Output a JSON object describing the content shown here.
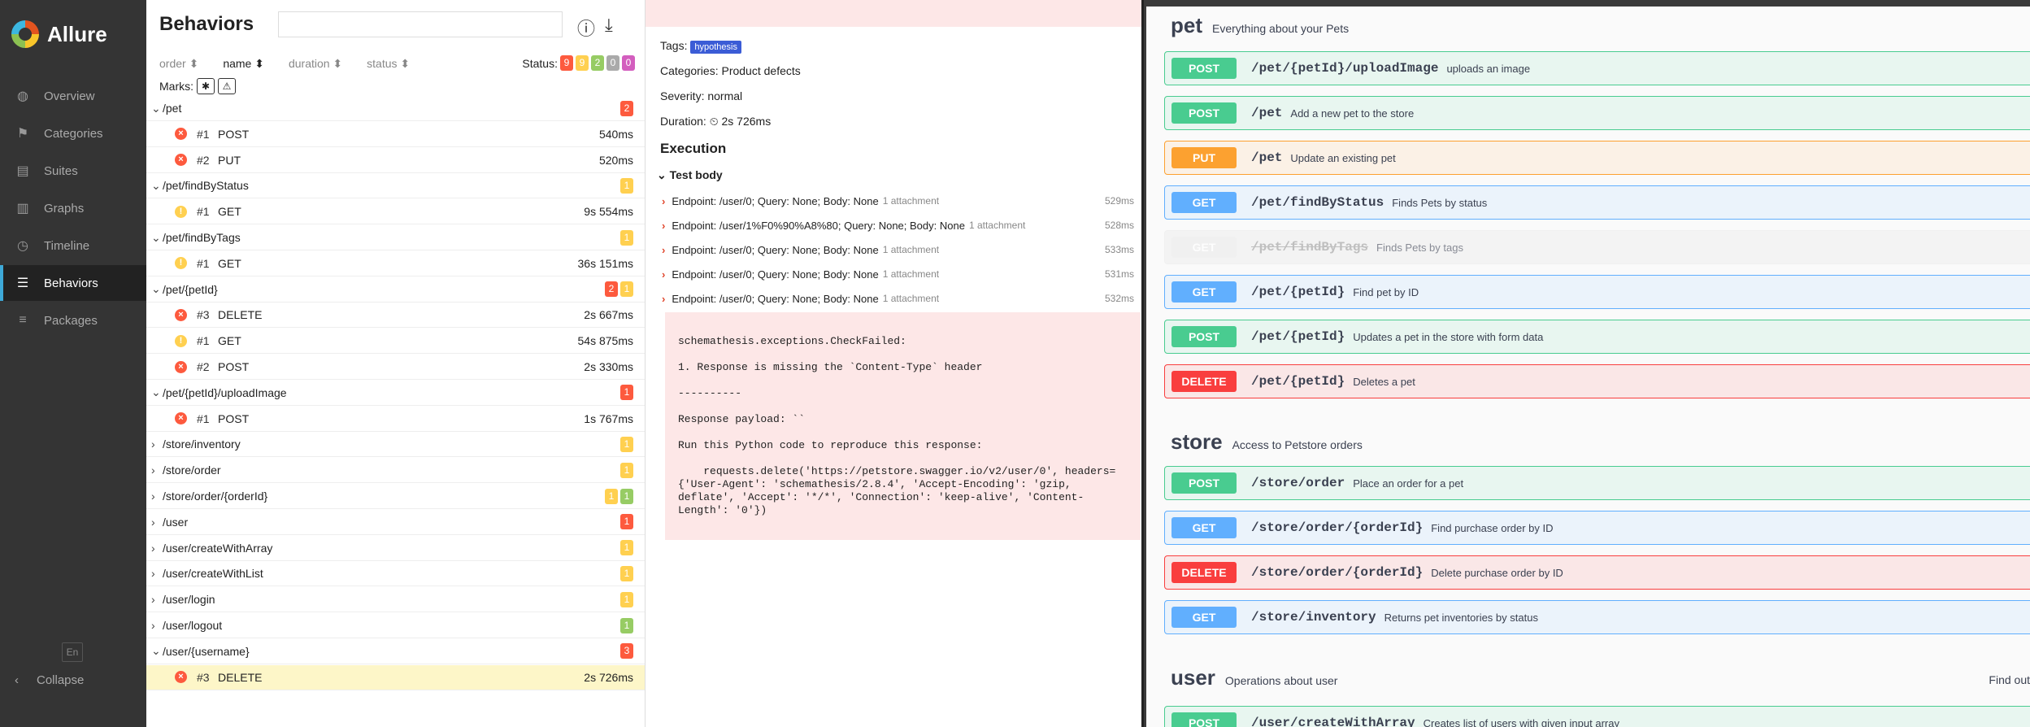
{
  "sidebar": {
    "brand": "Allure",
    "items": [
      {
        "label": "Overview",
        "icon": "overview-icon",
        "glyph": "◍"
      },
      {
        "label": "Categories",
        "icon": "flag-icon",
        "glyph": "⚑"
      },
      {
        "label": "Suites",
        "icon": "briefcase-icon",
        "glyph": "▤"
      },
      {
        "label": "Graphs",
        "icon": "bar-chart-icon",
        "glyph": "▥"
      },
      {
        "label": "Timeline",
        "icon": "clock-icon",
        "glyph": "◷"
      },
      {
        "label": "Behaviors",
        "icon": "list-icon",
        "glyph": "☰"
      },
      {
        "label": "Packages",
        "icon": "packages-icon",
        "glyph": "≡"
      }
    ],
    "lang": "En",
    "collapse": "Collapse"
  },
  "tree": {
    "title": "Behaviors",
    "sort": {
      "order": "order ⬍",
      "name": "name ⬍",
      "duration": "duration ⬍",
      "status": "status ⬍"
    },
    "status_label": "Status:",
    "status_counts": [
      "9",
      "9",
      "2",
      "0",
      "0"
    ],
    "marks_label": "Marks:",
    "marks": [
      "✱",
      "⚠"
    ],
    "rows": [
      {
        "type": "group",
        "label": "/pet",
        "badges": [
          {
            "v": "2",
            "c": "red"
          }
        ],
        "open": true
      },
      {
        "type": "leaf",
        "st": "fail",
        "num": "#1",
        "label": "POST",
        "dur": "540ms"
      },
      {
        "type": "leaf",
        "st": "fail",
        "num": "#2",
        "label": "PUT",
        "dur": "520ms"
      },
      {
        "type": "group",
        "label": "/pet/findByStatus",
        "badges": [
          {
            "v": "1",
            "c": "yel"
          }
        ],
        "open": true
      },
      {
        "type": "leaf",
        "st": "brk",
        "num": "#1",
        "label": "GET",
        "dur": "9s 554ms"
      },
      {
        "type": "group",
        "label": "/pet/findByTags",
        "badges": [
          {
            "v": "1",
            "c": "yel"
          }
        ],
        "open": true
      },
      {
        "type": "leaf",
        "st": "brk",
        "num": "#1",
        "label": "GET",
        "dur": "36s 151ms"
      },
      {
        "type": "group",
        "label": "/pet/{petId}",
        "badges": [
          {
            "v": "2",
            "c": "red"
          },
          {
            "v": "1",
            "c": "yel"
          }
        ],
        "open": true
      },
      {
        "type": "leaf",
        "st": "fail",
        "num": "#3",
        "label": "DELETE",
        "dur": "2s 667ms"
      },
      {
        "type": "leaf",
        "st": "brk",
        "num": "#1",
        "label": "GET",
        "dur": "54s 875ms"
      },
      {
        "type": "leaf",
        "st": "fail",
        "num": "#2",
        "label": "POST",
        "dur": "2s 330ms"
      },
      {
        "type": "group",
        "label": "/pet/{petId}/uploadImage",
        "badges": [
          {
            "v": "1",
            "c": "red"
          }
        ],
        "open": true
      },
      {
        "type": "leaf",
        "st": "fail",
        "num": "#1",
        "label": "POST",
        "dur": "1s 767ms"
      },
      {
        "type": "group",
        "label": "/store/inventory",
        "badges": [
          {
            "v": "1",
            "c": "yel"
          }
        ],
        "open": false
      },
      {
        "type": "group",
        "label": "/store/order",
        "badges": [
          {
            "v": "1",
            "c": "yel"
          }
        ],
        "open": false
      },
      {
        "type": "group",
        "label": "/store/order/{orderId}",
        "badges": [
          {
            "v": "1",
            "c": "yel"
          },
          {
            "v": "1",
            "c": "grn"
          }
        ],
        "open": false
      },
      {
        "type": "group",
        "label": "/user",
        "badges": [
          {
            "v": "1",
            "c": "red"
          }
        ],
        "open": false
      },
      {
        "type": "group",
        "label": "/user/createWithArray",
        "badges": [
          {
            "v": "1",
            "c": "yel"
          }
        ],
        "open": false
      },
      {
        "type": "group",
        "label": "/user/createWithList",
        "badges": [
          {
            "v": "1",
            "c": "yel"
          }
        ],
        "open": false
      },
      {
        "type": "group",
        "label": "/user/login",
        "badges": [
          {
            "v": "1",
            "c": "yel"
          }
        ],
        "open": false
      },
      {
        "type": "group",
        "label": "/user/logout",
        "badges": [
          {
            "v": "1",
            "c": "grn"
          }
        ],
        "open": false
      },
      {
        "type": "group",
        "label": "/user/{username}",
        "badges": [
          {
            "v": "3",
            "c": "red"
          }
        ],
        "open": true
      },
      {
        "type": "leaf",
        "st": "fail",
        "num": "#3",
        "label": "DELETE",
        "dur": "2s 726ms",
        "selected": true
      }
    ]
  },
  "detail": {
    "tags_label": "Tags:",
    "tag": "hypothesis",
    "categories": "Categories: Product defects",
    "severity": "Severity: normal",
    "duration": "Duration: ⏲ 2s 726ms",
    "execution": "Execution",
    "test_body": "Test body",
    "steps": [
      {
        "label": "Endpoint: /user/0; Query: None; Body: None",
        "att": "1 attachment",
        "dur": "529ms"
      },
      {
        "label": "Endpoint: /user/1%F0%90%A8%80; Query: None; Body: None",
        "att": "1 attachment",
        "dur": "528ms"
      },
      {
        "label": "Endpoint: /user/0; Query: None; Body: None",
        "att": "1 attachment",
        "dur": "533ms"
      },
      {
        "label": "Endpoint: /user/0; Query: None; Body: None",
        "att": "1 attachment",
        "dur": "531ms"
      },
      {
        "label": "Endpoint: /user/0; Query: None; Body: None",
        "att": "1 attachment",
        "dur": "532ms"
      }
    ],
    "error": "schemathesis.exceptions.CheckFailed:\n\n1. Response is missing the `Content-Type` header\n\n----------\n\nResponse payload: ``\n\nRun this Python code to reproduce this response:\n\n    requests.delete('https://petstore.swagger.io/v2/user/0', headers={'User-Agent': 'schemathesis/2.8.4', 'Accept-Encoding': 'gzip, deflate', 'Accept': '*/*', 'Connection': 'keep-alive', 'Content-Length': '0'})"
  },
  "swagger": {
    "sections": [
      {
        "name": "pet",
        "desc": "Everything about your Pets"
      },
      {
        "name": "store",
        "desc": "Access to Petstore orders"
      },
      {
        "name": "user",
        "desc": "Operations about user"
      }
    ],
    "find_out": "Find out",
    "ops": [
      {
        "m": "POST",
        "cls": "post",
        "p": "/pet/{petId}/uploadImage",
        "d": "uploads an image"
      },
      {
        "m": "POST",
        "cls": "post",
        "p": "/pet",
        "d": "Add a new pet to the store"
      },
      {
        "m": "PUT",
        "cls": "put",
        "p": "/pet",
        "d": "Update an existing pet"
      },
      {
        "m": "GET",
        "cls": "get",
        "p": "/pet/findByStatus",
        "d": "Finds Pets by status"
      },
      {
        "m": "GET",
        "cls": "dep",
        "p": "/pet/findByTags",
        "d": "Finds Pets by tags"
      },
      {
        "m": "GET",
        "cls": "get",
        "p": "/pet/{petId}",
        "d": "Find pet by ID"
      },
      {
        "m": "POST",
        "cls": "post",
        "p": "/pet/{petId}",
        "d": "Updates a pet in the store with form data"
      },
      {
        "m": "DELETE",
        "cls": "del",
        "p": "/pet/{petId}",
        "d": "Deletes a pet"
      },
      {
        "m": "POST",
        "cls": "post",
        "p": "/store/order",
        "d": "Place an order for a pet"
      },
      {
        "m": "GET",
        "cls": "get",
        "p": "/store/order/{orderId}",
        "d": "Find purchase order by ID"
      },
      {
        "m": "DELETE",
        "cls": "del",
        "p": "/store/order/{orderId}",
        "d": "Delete purchase order by ID"
      },
      {
        "m": "GET",
        "cls": "get",
        "p": "/store/inventory",
        "d": "Returns pet inventories by status"
      },
      {
        "m": "POST",
        "cls": "post",
        "p": "/user/createWithArray",
        "d": "Creates list of users with given input array"
      }
    ]
  }
}
